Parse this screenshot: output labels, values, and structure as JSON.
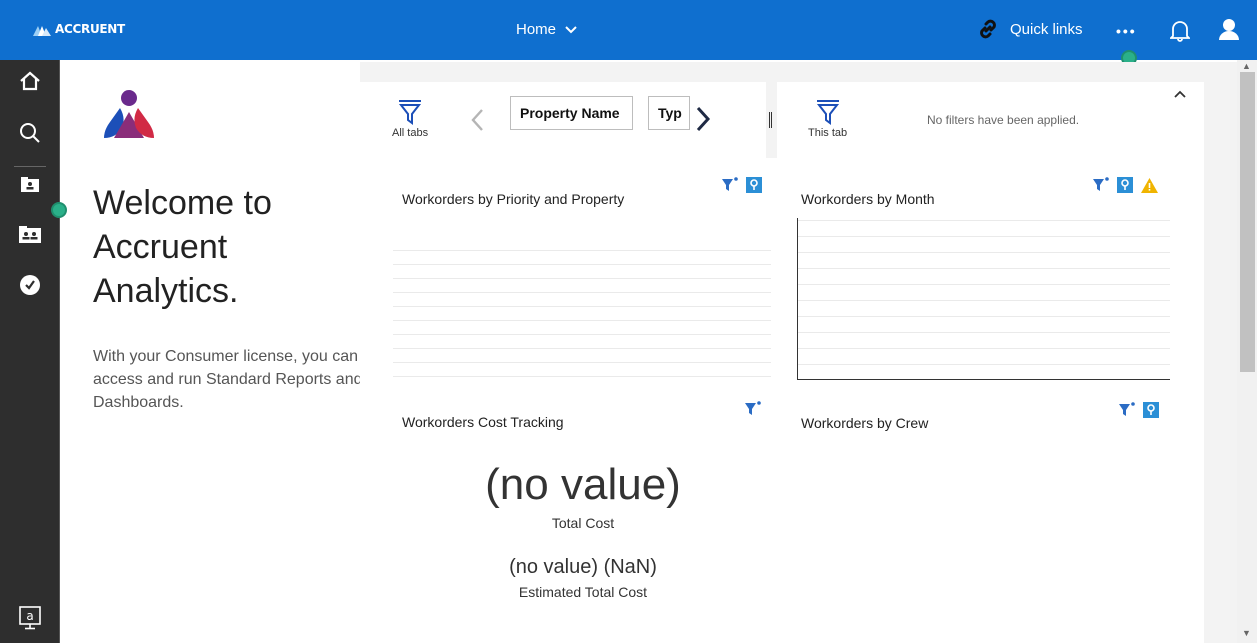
{
  "topbar": {
    "brand": "ACCRUENT",
    "home_menu": "Home",
    "quick_links": "Quick links",
    "colors": {
      "bar": "#0f6fcf",
      "text": "#ffffff"
    }
  },
  "rail": {
    "items": [
      {
        "icon": "home-icon"
      },
      {
        "icon": "search-icon"
      },
      {
        "icon": "folder-icon"
      },
      {
        "icon": "team-folder-icon"
      },
      {
        "icon": "recent-icon"
      }
    ],
    "bottom_icon": "my-content-icon",
    "bottom_label": "a"
  },
  "welcome": {
    "title": "Welcome to Accruent Analytics.",
    "description": "With your Consumer license, you can access and run Standard Reports and Dashboards."
  },
  "filters": {
    "all_tabs_label": "All tabs",
    "this_tab_label": "This tab",
    "chips": [
      "Property Name",
      "Typ"
    ],
    "no_filters_text": "No filters have been applied."
  },
  "widgets": {
    "priority_property": {
      "title": "Workorders by Priority and Property"
    },
    "by_month": {
      "title": "Workorders by Month"
    },
    "cost_tracking": {
      "title": "Workorders Cost Tracking",
      "total_value": "(no value)",
      "total_label": "Total Cost",
      "estimated_value": "(no value) (NaN)",
      "estimated_label": "Estimated Total Cost"
    },
    "by_crew": {
      "title": "Workorders by Crew"
    }
  }
}
